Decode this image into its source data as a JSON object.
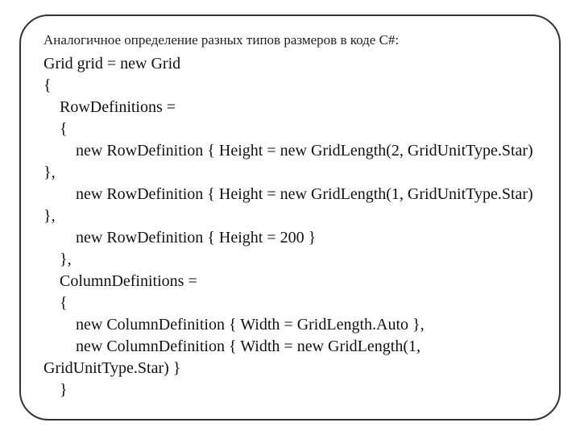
{
  "intro": "Аналогичное определение разных типов размеров в коде C#:",
  "code": "Grid grid = new Grid\n{\n    RowDefinitions =\n    {\n        new RowDefinition { Height = new GridLength(2, GridUnitType.Star) },\n        new RowDefinition { Height = new GridLength(1, GridUnitType.Star) },\n        new RowDefinition { Height = 200 }\n    },\n    ColumnDefinitions =\n    {\n        new ColumnDefinition { Width = GridLength.Auto },\n        new ColumnDefinition { Width = new GridLength(1, GridUnitType.Star) }\n    }"
}
